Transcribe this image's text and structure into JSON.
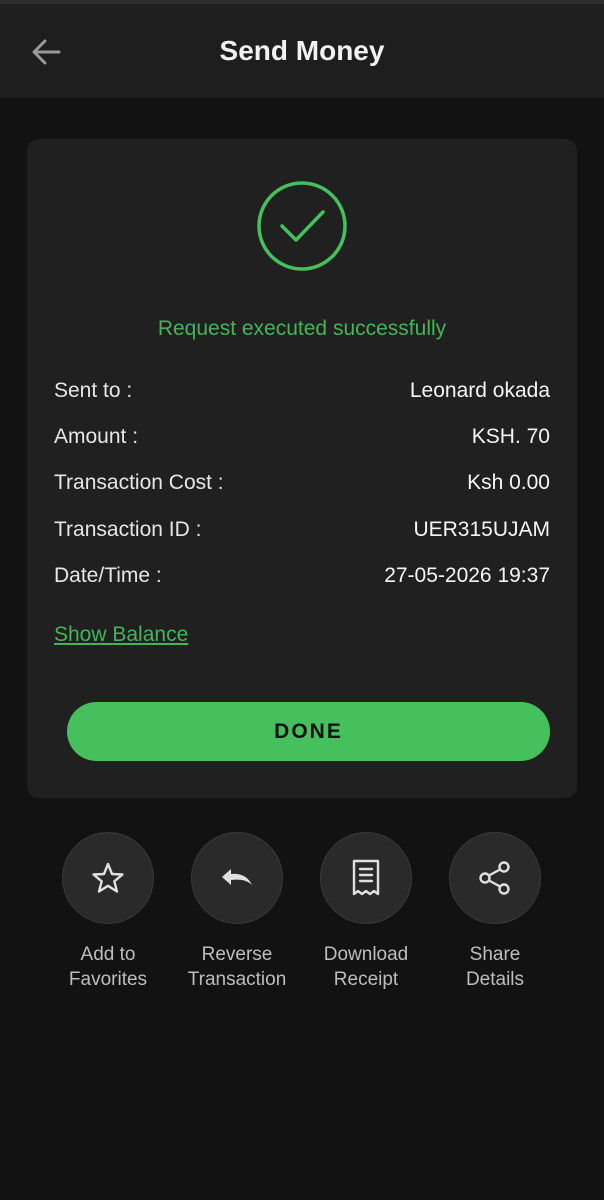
{
  "header": {
    "title": "Send Money",
    "back_icon": "arrow-left-icon"
  },
  "card": {
    "status_icon": "check-circle-icon",
    "status_message": "Request executed successfully",
    "details": [
      {
        "label": "Sent to :",
        "value": "Leonard okada"
      },
      {
        "label": "Amount :",
        "value": "KSH. 70"
      },
      {
        "label": "Transaction Cost :",
        "value": "Ksh 0.00"
      },
      {
        "label": "Transaction ID :",
        "value": "UER315UJAM"
      },
      {
        "label": "Date/Time :",
        "value": "27-05-2026 19:37"
      }
    ],
    "show_balance_label": "Show Balance",
    "done_label": "DONE"
  },
  "actions": [
    {
      "line1": "Add to",
      "line2": "Favorites",
      "icon": "star-icon"
    },
    {
      "line1": "Reverse",
      "line2": "Transaction",
      "icon": "undo-icon"
    },
    {
      "line1": "Download",
      "line2": "Receipt",
      "icon": "receipt-icon"
    },
    {
      "line1": "Share",
      "line2": "Details",
      "icon": "share-icon"
    }
  ],
  "colors": {
    "accent": "#45c05c",
    "success_text": "#46b35a",
    "background": "#121212",
    "card": "#202020"
  }
}
